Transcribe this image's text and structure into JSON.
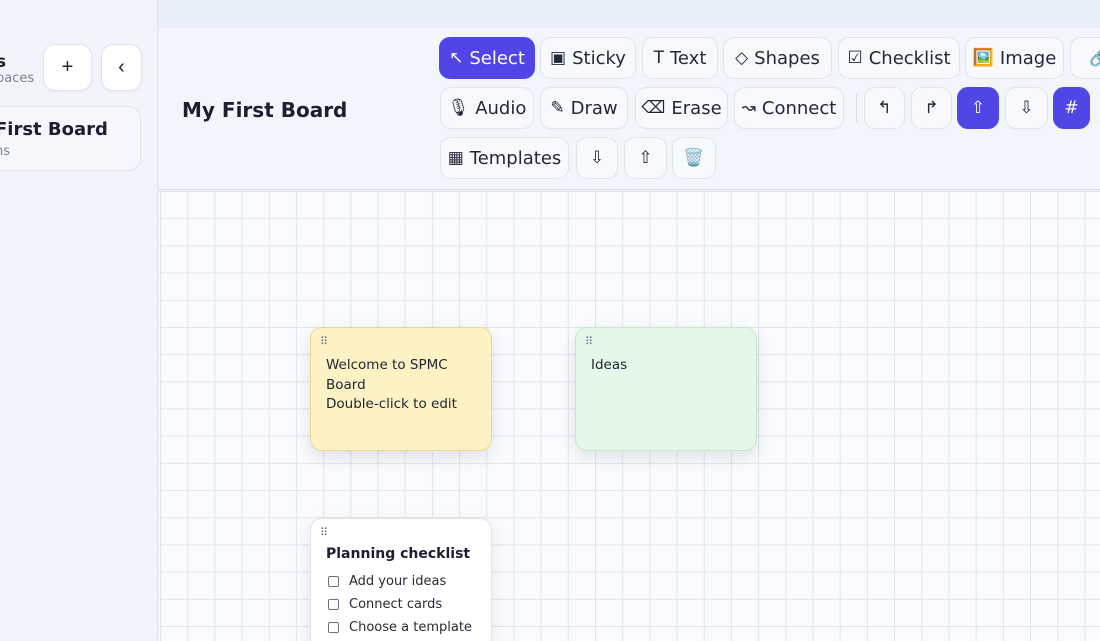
{
  "sidebar": {
    "workspace_title": "s",
    "workspace_subtitle": "paces",
    "add_label": "+",
    "collapse_label": "‹",
    "board_card": {
      "title": "First Board",
      "subtitle": "ns"
    }
  },
  "header": {
    "board_title": "My First Board",
    "tools_row1": [
      {
        "label": "Select",
        "icon": "↖",
        "icon_name": "cursor-arrow-icon",
        "active": true
      },
      {
        "label": "Sticky",
        "icon": "▣",
        "icon_name": "sticky-icon",
        "active": false
      },
      {
        "label": "Text",
        "icon": "T",
        "icon_name": "text-icon",
        "active": false
      },
      {
        "label": "Shapes",
        "icon": "◇",
        "icon_name": "diamond-icon",
        "active": false
      },
      {
        "label": "Checklist",
        "icon": "☑",
        "icon_name": "checkbox-icon",
        "active": false
      },
      {
        "label": "Image",
        "icon": "🖼️",
        "icon_name": "image-icon",
        "active": false
      },
      {
        "label": "",
        "icon": "🔗",
        "icon_name": "link-icon",
        "active": false
      }
    ],
    "tools_row2": [
      {
        "label": "Audio",
        "icon": "🎙",
        "icon_name": "microphone-icon"
      },
      {
        "label": "Draw",
        "icon": "✎",
        "icon_name": "pencil-icon"
      },
      {
        "label": "Erase",
        "icon": "⌫",
        "icon_name": "eraser-icon"
      },
      {
        "label": "Connect",
        "icon": "↝",
        "icon_name": "connector-icon"
      }
    ],
    "icon_row2": [
      {
        "icon": "↰",
        "icon_name": "undo-icon",
        "active": false
      },
      {
        "icon": "↱",
        "icon_name": "redo-icon",
        "active": false
      },
      {
        "icon": "⇧",
        "icon_name": "bring-forward-icon",
        "active": true
      },
      {
        "icon": "⇩",
        "icon_name": "send-backward-icon",
        "active": false
      },
      {
        "icon": "#",
        "icon_name": "grid-toggle-icon",
        "active": true
      }
    ],
    "row3": {
      "templates_label": "Templates",
      "templates_icon": "▦",
      "icons": [
        {
          "icon": "⇩",
          "icon_name": "export-down-icon"
        },
        {
          "icon": "⇧",
          "icon_name": "import-up-icon"
        },
        {
          "icon": "🗑️",
          "icon_name": "trash-icon"
        }
      ]
    }
  },
  "canvas": {
    "notes": [
      {
        "color": "yellow",
        "lines": [
          "Welcome to SPMC",
          "Board",
          "Double-click to edit"
        ]
      },
      {
        "color": "green",
        "lines": [
          "Ideas"
        ]
      }
    ],
    "checklist": {
      "title": "Planning checklist",
      "items": [
        "Add your ideas",
        "Connect cards",
        "Choose a template"
      ]
    }
  },
  "colors": {
    "accent": "#4f46e5",
    "note_yellow": "#fdf2c4",
    "note_green": "#e3f8e8"
  }
}
